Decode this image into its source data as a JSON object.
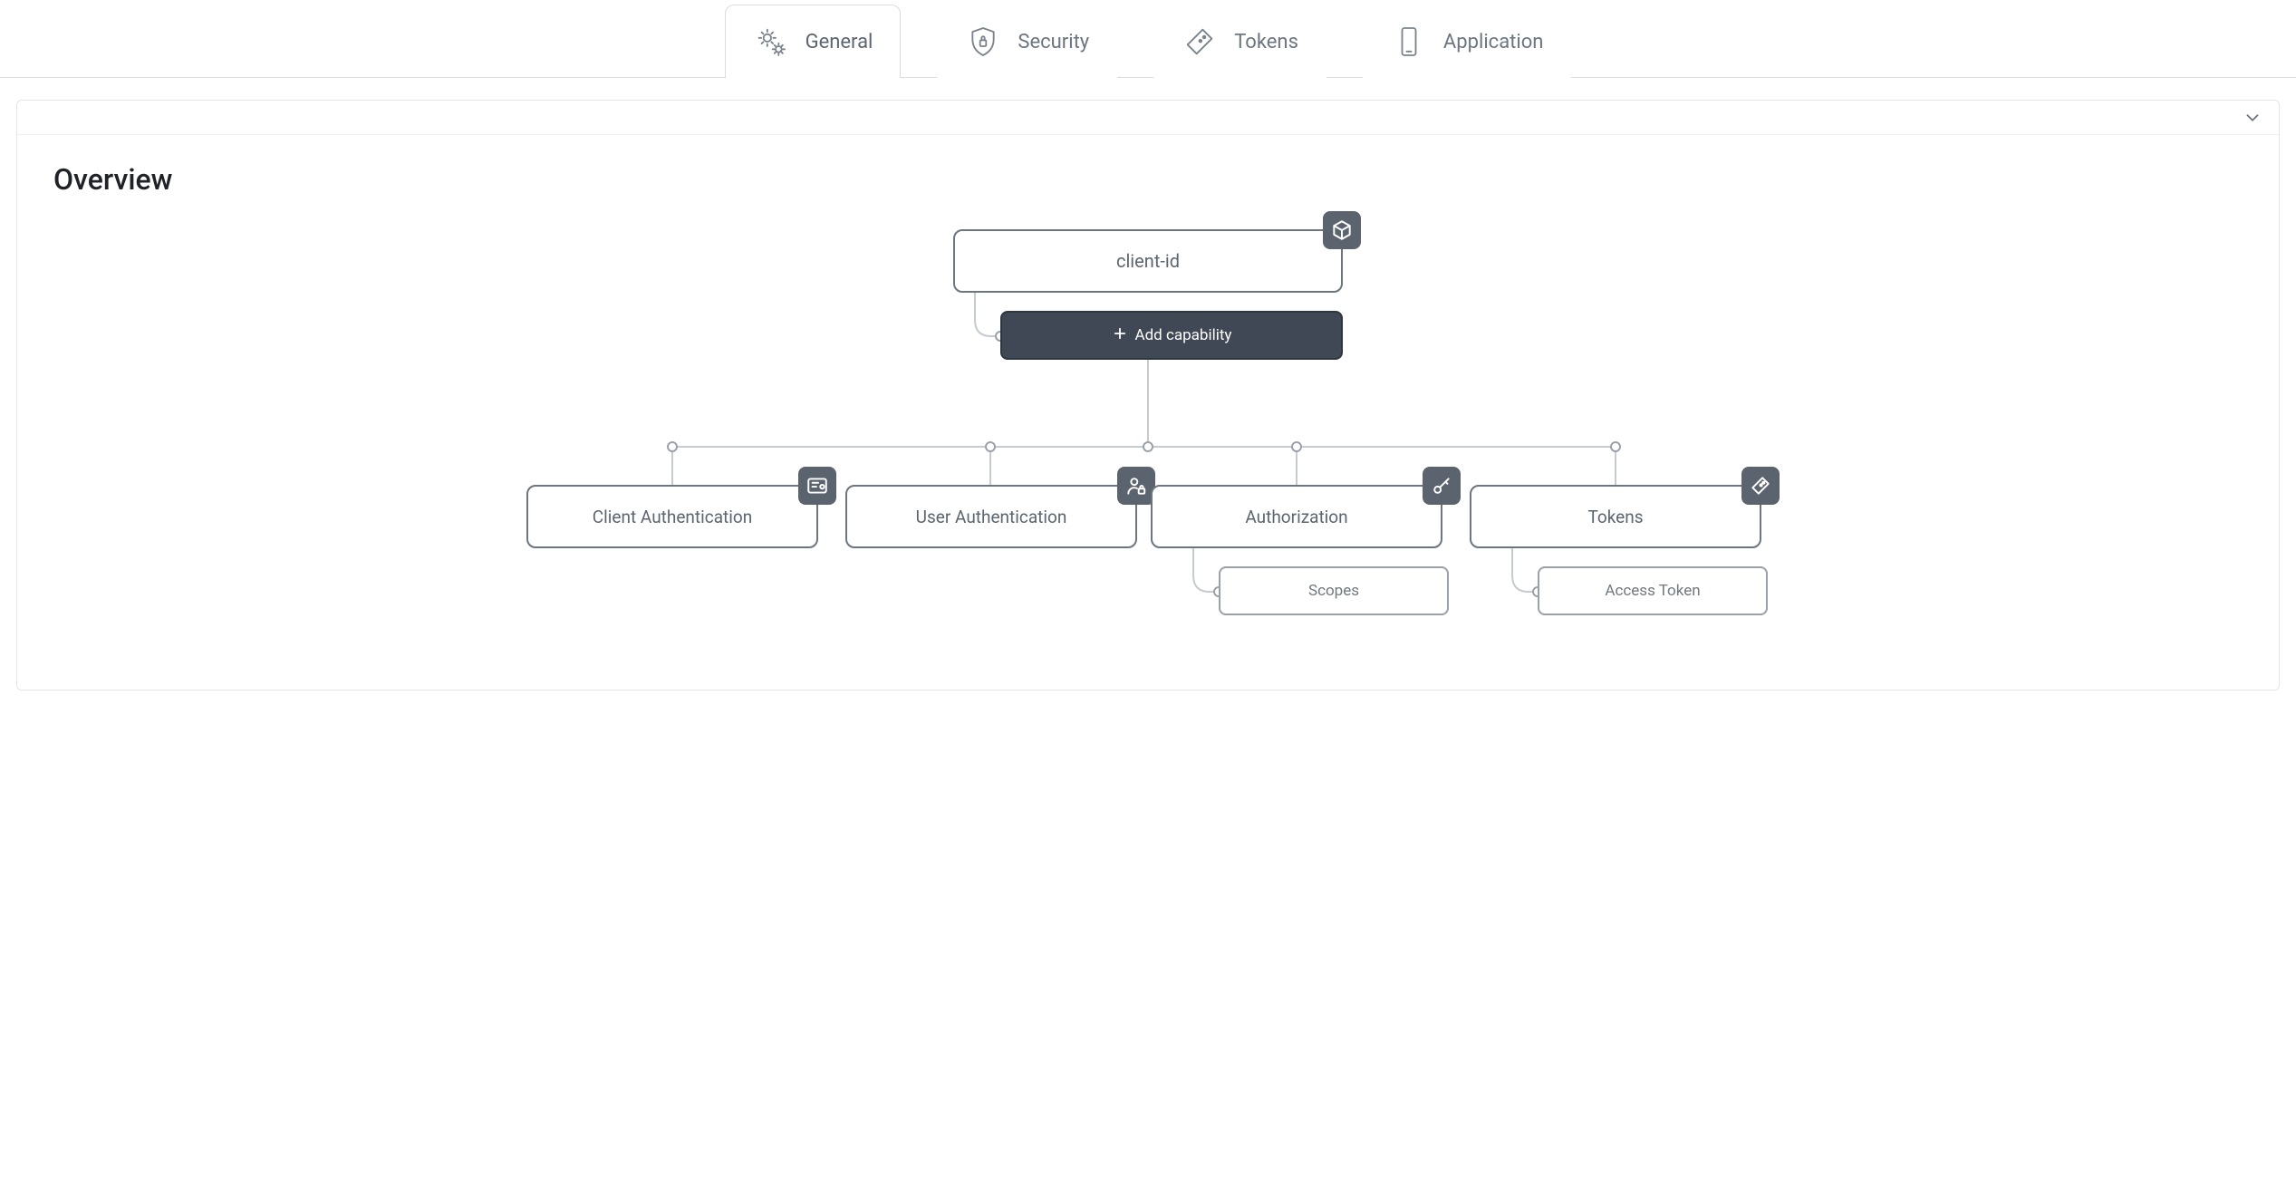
{
  "tabs": [
    {
      "label": "General"
    },
    {
      "label": "Security"
    },
    {
      "label": "Tokens"
    },
    {
      "label": "Application"
    }
  ],
  "panel": {
    "title": "Overview"
  },
  "diagram": {
    "root": {
      "label": "client-id"
    },
    "add_capability_label": "Add capability",
    "cards": [
      {
        "label": "Client Authentication"
      },
      {
        "label": "User Authentication"
      },
      {
        "label": "Authorization"
      },
      {
        "label": "Tokens"
      }
    ],
    "authorization_sub": {
      "label": "Scopes"
    },
    "tokens_sub": {
      "label": "Access Token"
    }
  }
}
